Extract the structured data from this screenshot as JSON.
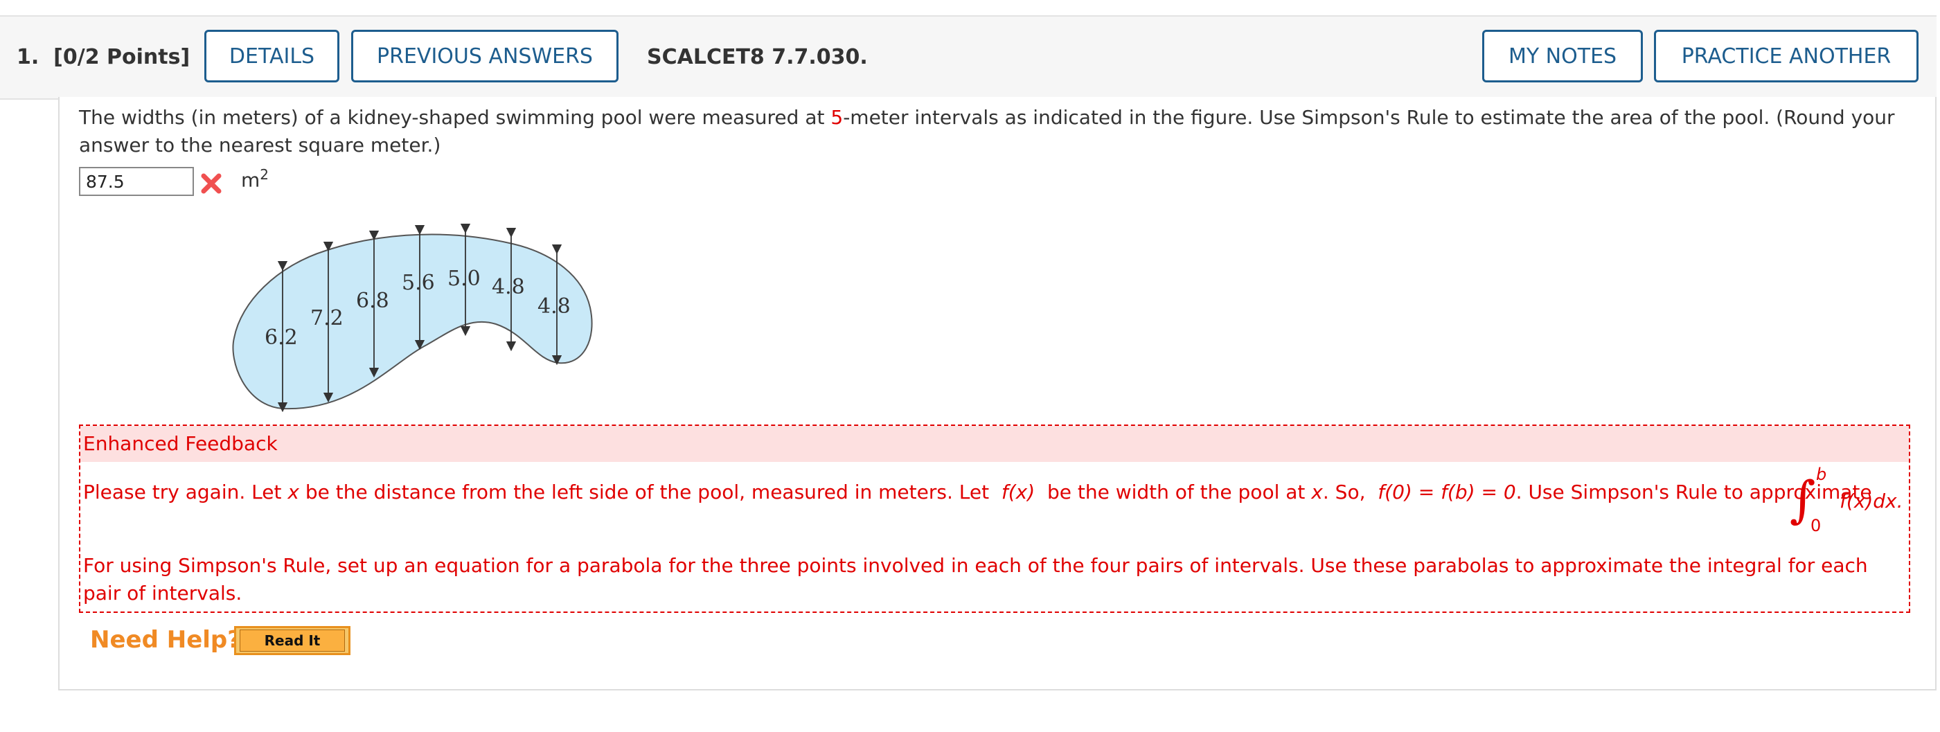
{
  "header": {
    "question_number": "1.",
    "points": "[0/2 Points]",
    "details_label": "DETAILS",
    "previous_answers_label": "PREVIOUS ANSWERS",
    "question_code": "SCALCET8 7.7.030.",
    "my_notes_label": "MY NOTES",
    "practice_another_label": "PRACTICE ANOTHER"
  },
  "problem": {
    "text_before": "The widths (in meters) of a kidney-shaped swimming pool were measured at ",
    "interval": "5",
    "text_after": "-meter intervals as indicated in the figure. Use Simpson's Rule to estimate the area of the pool. (Round your answer to the nearest square meter.)"
  },
  "answer": {
    "value": "87.5",
    "status": "incorrect",
    "status_icon": "x-mark-icon",
    "unit": "m",
    "unit_exponent": "2"
  },
  "figure": {
    "widths": [
      "6.2",
      "7.2",
      "6.8",
      "5.6",
      "5.0",
      "4.8",
      "4.8"
    ],
    "pool_color": "#c9e9f8"
  },
  "feedback": {
    "heading": "Enhanced Feedback",
    "line1": {
      "p1": "Please try again. Let ",
      "x1": "x",
      "p2": " be the distance from the left side of the pool, measured in meters. Let ",
      "fx": "f(x)",
      "p3": " be the width of the pool at ",
      "x2": "x",
      "p4": ". So, ",
      "f0": "f(0) = f(b) = 0",
      "p5": ". Use Simpson's Rule to approximate"
    },
    "integral": {
      "upper": "b",
      "lower": "0",
      "integrand": "f(x)dx."
    },
    "paragraph2": "For using Simpson's Rule, set up an equation for a parabola for the three points involved in each of the four pairs of intervals. Use these parabolas to approximate the integral for each pair of intervals.",
    "color": "#e00000"
  },
  "help": {
    "need_help_label": "Need Help?",
    "read_it_label": "Read It"
  }
}
